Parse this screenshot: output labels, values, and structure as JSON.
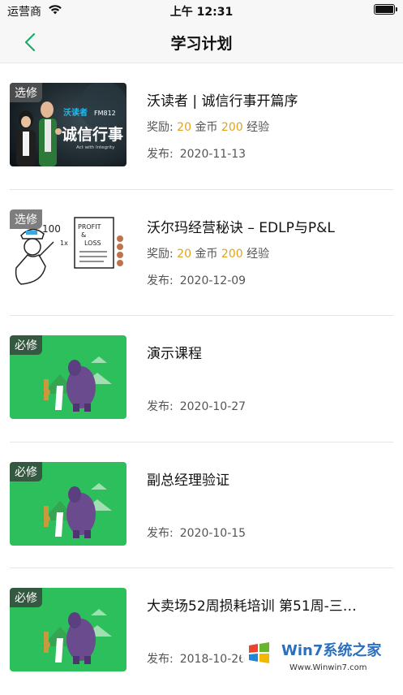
{
  "status_bar": {
    "carrier": "运营商",
    "time": "上午 12:31"
  },
  "nav": {
    "title": "学习计划"
  },
  "labels": {
    "reward": "奖励:",
    "coin_unit": "金币",
    "exp_unit": "经验",
    "published": "发布:"
  },
  "items": [
    {
      "tag": "选修",
      "title": "沃读者 | 诚信行事开篇序",
      "coins": "20",
      "exp": "200",
      "date": "2020-11-13",
      "thumb_text": {
        "brand": "沃读者",
        "channel": "FM812",
        "headline": "诚信行事",
        "sub": "Act with Integrity"
      }
    },
    {
      "tag": "选修",
      "title": "沃尔玛经营秘诀 – EDLP与P&L",
      "coins": "20",
      "exp": "200",
      "date": "2020-12-09",
      "thumb_text": {
        "big": "100",
        "small": "1x",
        "p1": "PROFIT",
        "p2": "&",
        "p3": "LOSS"
      }
    },
    {
      "tag": "必修",
      "title": "演示课程",
      "date": "2020-10-27"
    },
    {
      "tag": "必修",
      "title": "副总经理验证",
      "date": "2020-10-15"
    },
    {
      "tag": "必修",
      "title": "大卖场52周损耗培训 第51周-三…",
      "date": "2018-10-26"
    }
  ],
  "watermark": {
    "brand": "Win7系统之家",
    "url": "Www.Winwin7.com"
  },
  "colors": {
    "accent": "#1aad6e",
    "coin": "#e2a31a",
    "thumb_green": "#2dbf5b"
  }
}
